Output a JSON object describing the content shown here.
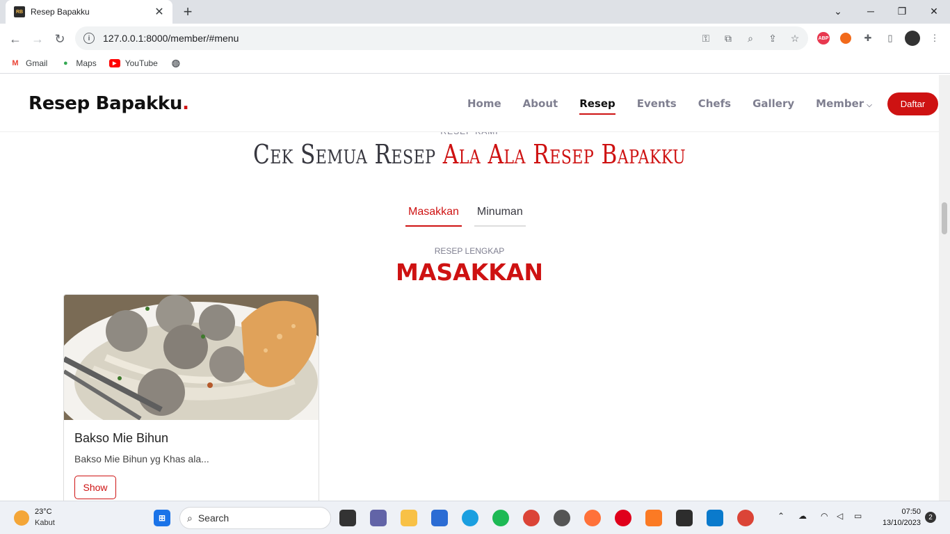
{
  "browser": {
    "tab_title": "Resep Bapakku",
    "favicon_text": "RB",
    "url": "127.0.0.1:8000/member/#menu",
    "bookmarks": [
      {
        "label": "Gmail",
        "icon": "gmail-icon"
      },
      {
        "label": "Maps",
        "icon": "maps-icon"
      },
      {
        "label": "YouTube",
        "icon": "youtube-icon"
      }
    ],
    "extensions": {
      "abp": "ABP"
    }
  },
  "header": {
    "logo": "Resep Bapakku",
    "logo_dot": ".",
    "nav": [
      "Home",
      "About",
      "Resep",
      "Events",
      "Chefs",
      "Gallery",
      "Member"
    ],
    "active_nav": "Resep",
    "cta": "Daftar"
  },
  "section": {
    "subtitle": "RESEP KAMI",
    "title_plain": "Cek Semua Resep ",
    "title_accent": "Ala Ala Resep Bapakku"
  },
  "menu_tabs": [
    "Masakkan",
    "Minuman"
  ],
  "active_tab": "Masakkan",
  "recipes": {
    "subtitle": "RESEP LENGKAP",
    "title": "MASAKKAN",
    "items": [
      {
        "title": "Bakso Mie Bihun",
        "description": "Bakso Mie Bihun yg Khas ala...",
        "button": "Show"
      }
    ]
  },
  "taskbar": {
    "temperature": "23°C",
    "weather": "Kabut",
    "search": "Search",
    "time": "07:50",
    "date": "13/10/2023",
    "notifications": "2"
  },
  "colors": {
    "accent": "#ce1212",
    "text": "#37373f",
    "muted": "#7f7f90"
  }
}
